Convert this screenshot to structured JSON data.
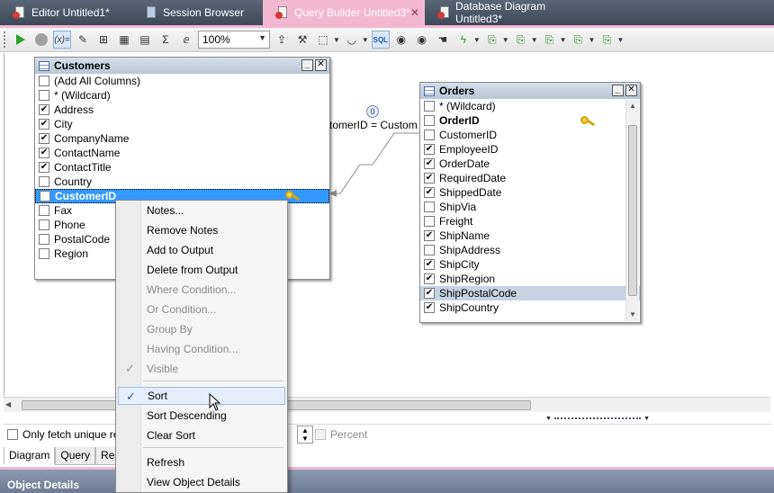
{
  "tabs": [
    {
      "label": "Editor Untitled1*"
    },
    {
      "label": "Session Browser"
    },
    {
      "label": "Query Builder Untitled3*"
    },
    {
      "label": "Database Diagram Untitled3*"
    }
  ],
  "toolbar": {
    "zoom": "100%"
  },
  "customers": {
    "title": "Customers",
    "rows": [
      {
        "label": "(Add All Columns)",
        "checked": false
      },
      {
        "label": "* (Wildcard)",
        "checked": false
      },
      {
        "label": "Address",
        "checked": true
      },
      {
        "label": "City",
        "checked": true
      },
      {
        "label": "CompanyName",
        "checked": true
      },
      {
        "label": "ContactName",
        "checked": true
      },
      {
        "label": "ContactTitle",
        "checked": true
      },
      {
        "label": "Country",
        "checked": false
      },
      {
        "label": "CustomerID",
        "checked": false
      },
      {
        "label": "Fax",
        "checked": false
      },
      {
        "label": "Phone",
        "checked": false
      },
      {
        "label": "PostalCode",
        "checked": false
      },
      {
        "label": "Region",
        "checked": false
      }
    ]
  },
  "orders": {
    "title": "Orders",
    "rows": [
      {
        "label": "* (Wildcard)",
        "checked": false
      },
      {
        "label": "OrderID",
        "checked": false
      },
      {
        "label": "CustomerID",
        "checked": false
      },
      {
        "label": "EmployeeID",
        "checked": true
      },
      {
        "label": "OrderDate",
        "checked": true
      },
      {
        "label": "RequiredDate",
        "checked": true
      },
      {
        "label": "ShippedDate",
        "checked": true
      },
      {
        "label": "ShipVia",
        "checked": false
      },
      {
        "label": "Freight",
        "checked": false
      },
      {
        "label": "ShipName",
        "checked": true
      },
      {
        "label": "ShipAddress",
        "checked": false
      },
      {
        "label": "ShipCity",
        "checked": true
      },
      {
        "label": "ShipRegion",
        "checked": true
      },
      {
        "label": "ShipPostalCode",
        "checked": true
      },
      {
        "label": "ShipCountry",
        "checked": true
      }
    ]
  },
  "join": {
    "label": "tomerID = Custom",
    "badge": "0"
  },
  "context_menu": {
    "items": [
      {
        "label": "Notes...",
        "disabled": false
      },
      {
        "label": "Remove Notes",
        "disabled": false
      },
      {
        "label": "Add to Output",
        "disabled": false
      },
      {
        "label": "Delete from Output",
        "disabled": false
      },
      {
        "label": "Where Condition...",
        "disabled": true
      },
      {
        "label": "Or Condition...",
        "disabled": true
      },
      {
        "label": "Group By",
        "disabled": true
      },
      {
        "label": "Having Condition...",
        "disabled": true
      },
      {
        "label": "Visible",
        "disabled": true
      },
      {
        "label": "Sort",
        "disabled": false
      },
      {
        "label": "Sort Descending",
        "disabled": false
      },
      {
        "label": "Clear Sort",
        "disabled": false
      },
      {
        "label": "Refresh",
        "disabled": false
      },
      {
        "label": "View Object Details",
        "disabled": false
      }
    ]
  },
  "options": {
    "unique_label": "Only fetch unique rec",
    "percent_label": "Percent"
  },
  "bottom_tabs": [
    {
      "label": "Diagram"
    },
    {
      "label": "Query"
    },
    {
      "label": "Resul"
    }
  ],
  "object_details": {
    "title": "Object Details"
  },
  "colors": {
    "accent_pink": "#f3b8d0",
    "selection_blue": "#3399ff",
    "panel_header": "#6c7c94"
  }
}
